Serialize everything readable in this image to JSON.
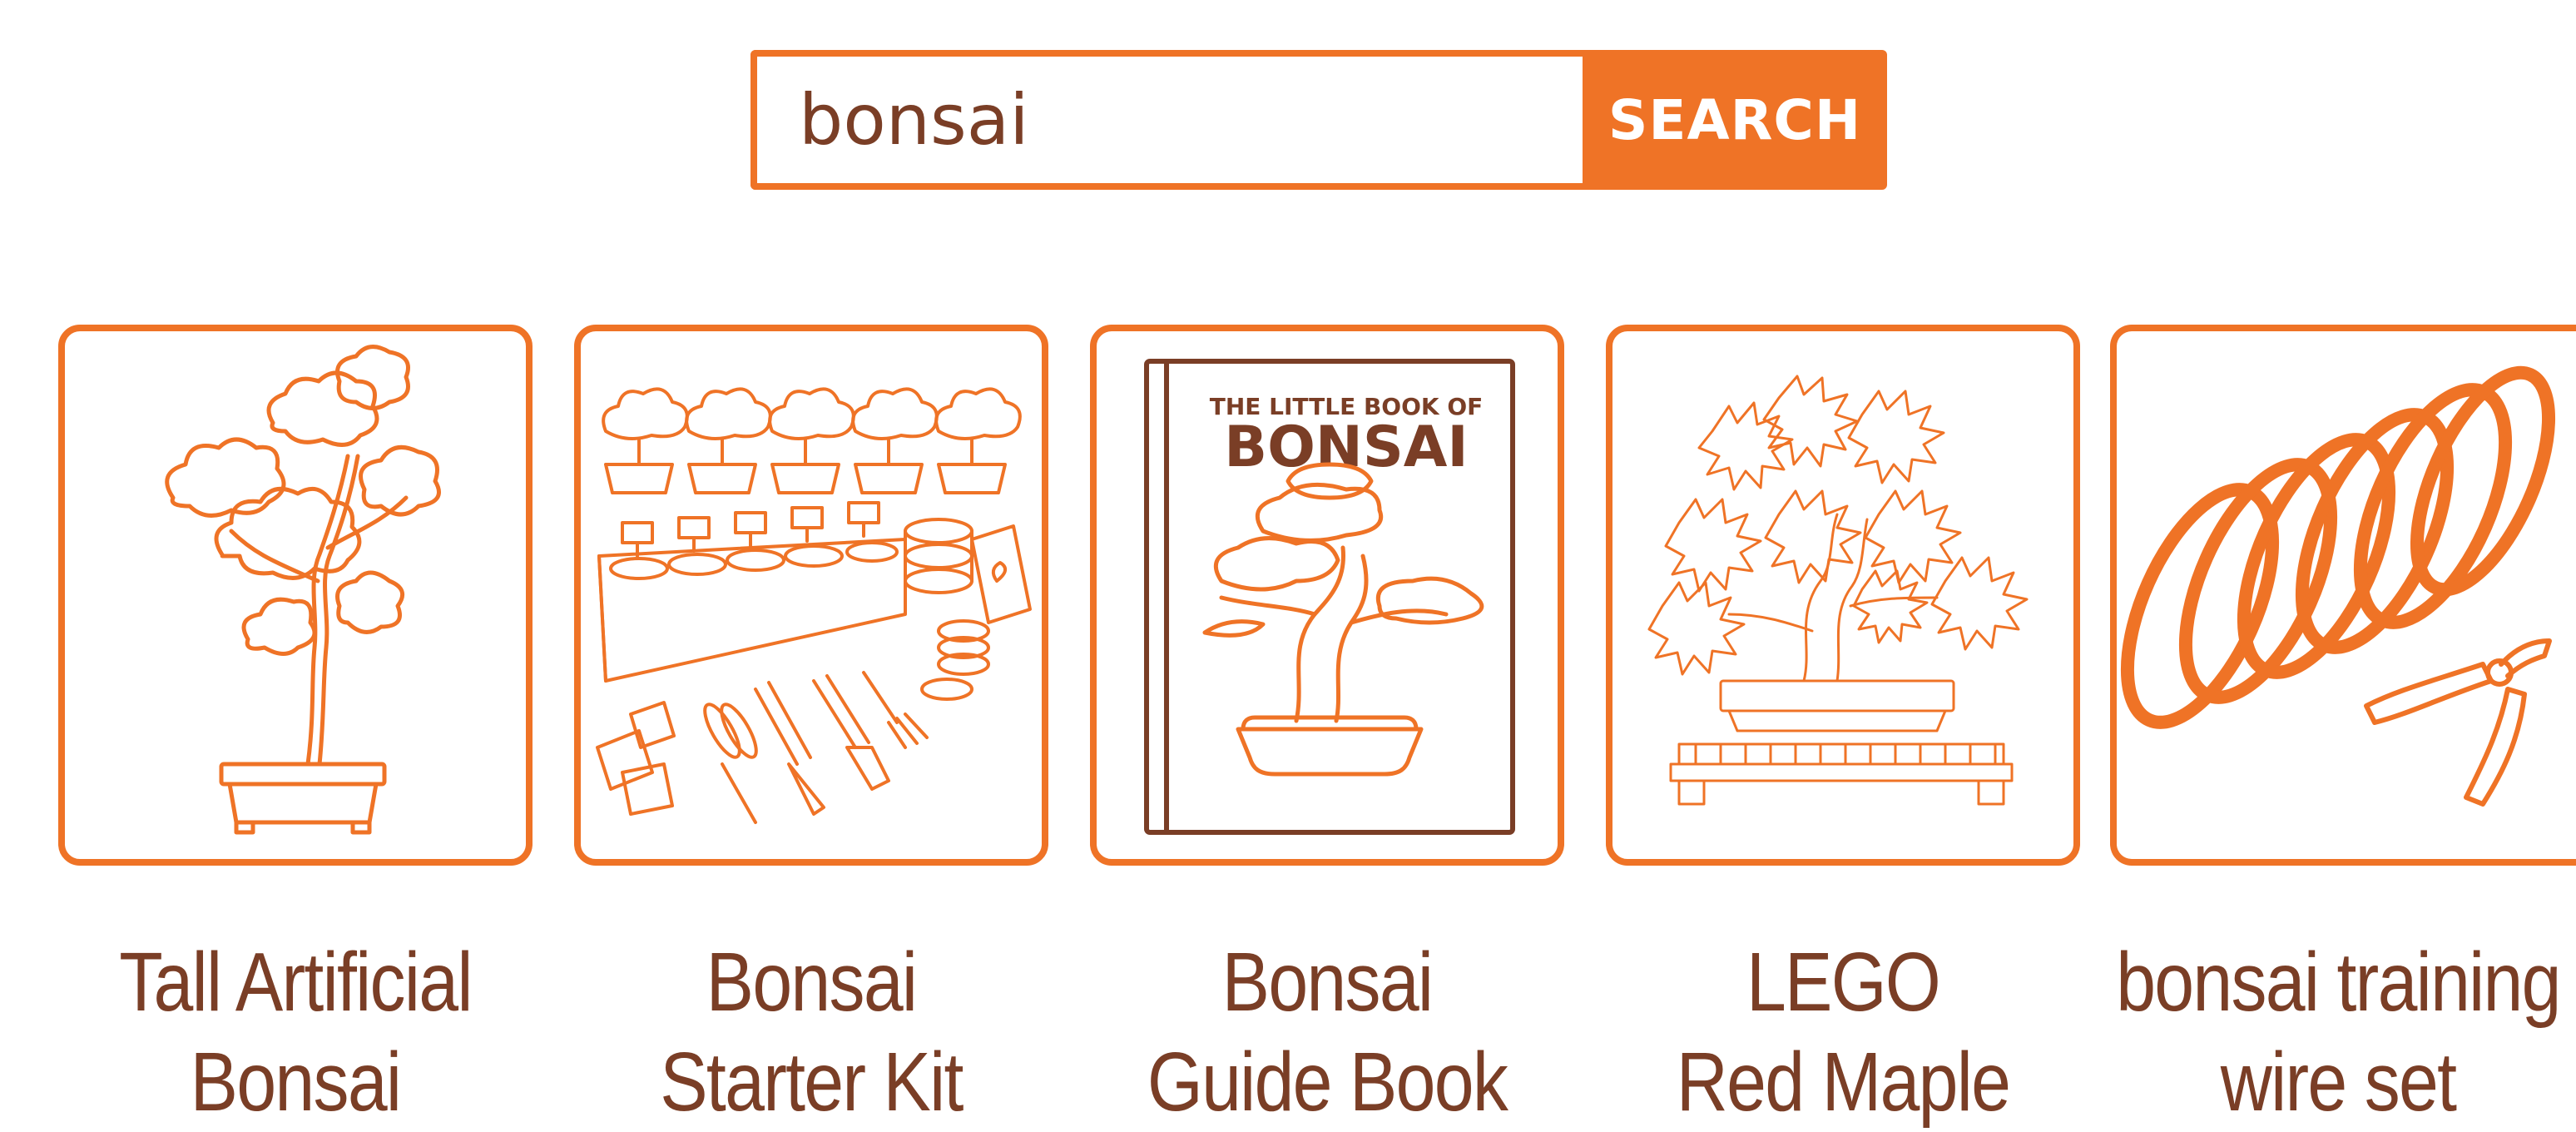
{
  "search": {
    "query": "bonsai",
    "button_label": "SEARCH"
  },
  "results": [
    {
      "line1": "Tall Artificial",
      "line2": "Bonsai",
      "icon": "artificial-bonsai-tree-icon"
    },
    {
      "line1": "Bonsai",
      "line2": "Starter Kit",
      "icon": "starter-kit-icon"
    },
    {
      "line1": "Bonsai",
      "line2": "Guide Book",
      "icon": "guide-book-icon",
      "book_cover": {
        "line1": "THE LITTLE BOOK OF",
        "line2": "BONSAI"
      }
    },
    {
      "line1": "LEGO",
      "line2": "Red Maple",
      "icon": "red-maple-bonsai-icon"
    },
    {
      "line1": "bonsai training",
      "line2": "wire set",
      "icon": "wire-coil-pliers-icon"
    }
  ],
  "colors": {
    "accent": "#ef7326",
    "text": "#7a3e26",
    "book_frame": "#7a3e26",
    "background": "#ffffff"
  }
}
